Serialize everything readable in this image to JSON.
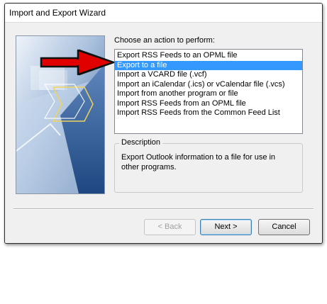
{
  "window": {
    "title": "Import and Export Wizard"
  },
  "wizard": {
    "prompt": "Choose an action to perform:",
    "actions": [
      "Export RSS Feeds to an OPML file",
      "Export to a file",
      "Import a VCARD file (.vcf)",
      "Import an iCalendar (.ics) or vCalendar file (.vcs)",
      "Import from another program or file",
      "Import RSS Feeds from an OPML file",
      "Import RSS Feeds from the Common Feed List"
    ],
    "selected_index": 1,
    "description_label": "Description",
    "description_text": "Export Outlook information to a file for use in other programs."
  },
  "buttons": {
    "back": "< Back",
    "next": "Next >",
    "cancel": "Cancel"
  },
  "colors": {
    "selection": "#3399ff",
    "arrow": "#e00000"
  }
}
